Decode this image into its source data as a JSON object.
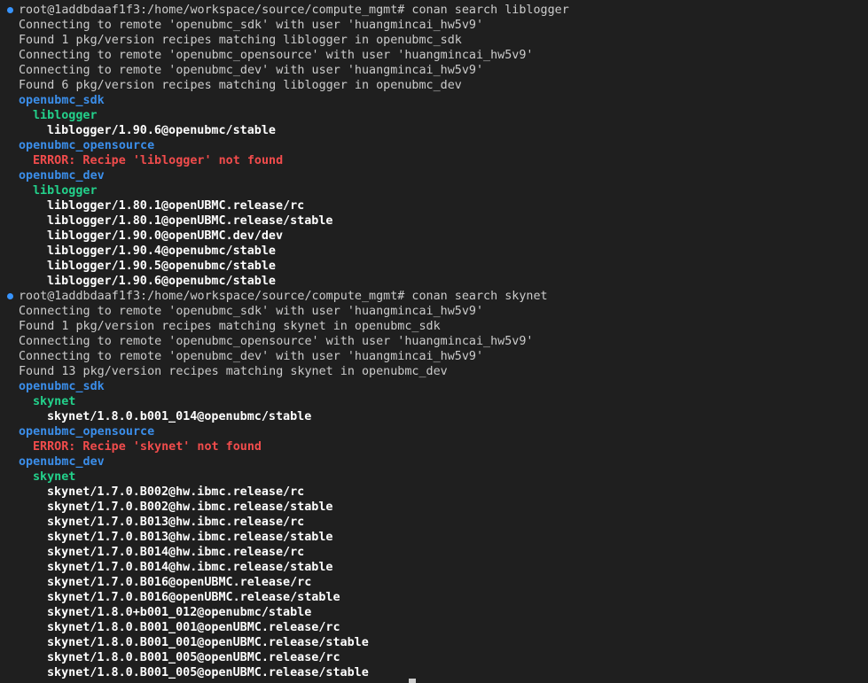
{
  "terminal": {
    "lines": [
      {
        "kind": "prompt",
        "text": "root@1addbdaaf1f3:/home/workspace/source/compute_mgmt# conan search liblogger"
      },
      {
        "kind": "plain",
        "text": "Connecting to remote 'openubmc_sdk' with user 'huangmincai_hw5v9'"
      },
      {
        "kind": "plain",
        "text": "Found 1 pkg/version recipes matching liblogger in openubmc_sdk"
      },
      {
        "kind": "plain",
        "text": "Connecting to remote 'openubmc_opensource' with user 'huangmincai_hw5v9'"
      },
      {
        "kind": "plain",
        "text": "Connecting to remote 'openubmc_dev' with user 'huangmincai_hw5v9'"
      },
      {
        "kind": "plain",
        "text": "Found 6 pkg/version recipes matching liblogger in openubmc_dev"
      },
      {
        "kind": "remote",
        "text": "openubmc_sdk"
      },
      {
        "kind": "pkg",
        "text": "liblogger"
      },
      {
        "kind": "ref",
        "text": "liblogger/1.90.6@openubmc/stable"
      },
      {
        "kind": "remote",
        "text": "openubmc_opensource"
      },
      {
        "kind": "error",
        "text": "ERROR: Recipe 'liblogger' not found"
      },
      {
        "kind": "remote",
        "text": "openubmc_dev"
      },
      {
        "kind": "pkg",
        "text": "liblogger"
      },
      {
        "kind": "ref",
        "text": "liblogger/1.80.1@openUBMC.release/rc"
      },
      {
        "kind": "ref",
        "text": "liblogger/1.80.1@openUBMC.release/stable"
      },
      {
        "kind": "ref",
        "text": "liblogger/1.90.0@openUBMC.dev/dev"
      },
      {
        "kind": "ref",
        "text": "liblogger/1.90.4@openubmc/stable"
      },
      {
        "kind": "ref",
        "text": "liblogger/1.90.5@openubmc/stable"
      },
      {
        "kind": "ref",
        "text": "liblogger/1.90.6@openubmc/stable"
      },
      {
        "kind": "prompt",
        "text": "root@1addbdaaf1f3:/home/workspace/source/compute_mgmt# conan search skynet"
      },
      {
        "kind": "plain",
        "text": "Connecting to remote 'openubmc_sdk' with user 'huangmincai_hw5v9'"
      },
      {
        "kind": "plain",
        "text": "Found 1 pkg/version recipes matching skynet in openubmc_sdk"
      },
      {
        "kind": "plain",
        "text": "Connecting to remote 'openubmc_opensource' with user 'huangmincai_hw5v9'"
      },
      {
        "kind": "plain",
        "text": "Connecting to remote 'openubmc_dev' with user 'huangmincai_hw5v9'"
      },
      {
        "kind": "plain",
        "text": "Found 13 pkg/version recipes matching skynet in openubmc_dev"
      },
      {
        "kind": "remote",
        "text": "openubmc_sdk"
      },
      {
        "kind": "pkg",
        "text": "skynet"
      },
      {
        "kind": "ref",
        "text": "skynet/1.8.0.b001_014@openubmc/stable"
      },
      {
        "kind": "remote",
        "text": "openubmc_opensource"
      },
      {
        "kind": "error",
        "text": "ERROR: Recipe 'skynet' not found"
      },
      {
        "kind": "remote",
        "text": "openubmc_dev"
      },
      {
        "kind": "pkg",
        "text": "skynet"
      },
      {
        "kind": "ref",
        "text": "skynet/1.7.0.B002@hw.ibmc.release/rc"
      },
      {
        "kind": "ref",
        "text": "skynet/1.7.0.B002@hw.ibmc.release/stable"
      },
      {
        "kind": "ref",
        "text": "skynet/1.7.0.B013@hw.ibmc.release/rc"
      },
      {
        "kind": "ref",
        "text": "skynet/1.7.0.B013@hw.ibmc.release/stable"
      },
      {
        "kind": "ref",
        "text": "skynet/1.7.0.B014@hw.ibmc.release/rc"
      },
      {
        "kind": "ref",
        "text": "skynet/1.7.0.B014@hw.ibmc.release/stable"
      },
      {
        "kind": "ref",
        "text": "skynet/1.7.0.B016@openUBMC.release/rc"
      },
      {
        "kind": "ref",
        "text": "skynet/1.7.0.B016@openUBMC.release/stable"
      },
      {
        "kind": "ref",
        "text": "skynet/1.8.0+b001_012@openubmc/stable"
      },
      {
        "kind": "ref",
        "text": "skynet/1.8.0.B001_001@openUBMC.release/rc"
      },
      {
        "kind": "ref",
        "text": "skynet/1.8.0.B001_001@openUBMC.release/stable"
      },
      {
        "kind": "ref",
        "text": "skynet/1.8.0.B001_005@openUBMC.release/rc"
      },
      {
        "kind": "ref",
        "text": "skynet/1.8.0.B001_005@openUBMC.release/stable"
      }
    ]
  },
  "colors": {
    "background": "#1f1f1f",
    "plain": "#cccccc",
    "remote": "#3b8eea",
    "package": "#23d18b",
    "reference": "#ffffff",
    "error": "#f14c4c",
    "prompt_dot": "#3794ff"
  },
  "icons": {
    "prompt_marker": "command-decoration-dot-icon"
  }
}
